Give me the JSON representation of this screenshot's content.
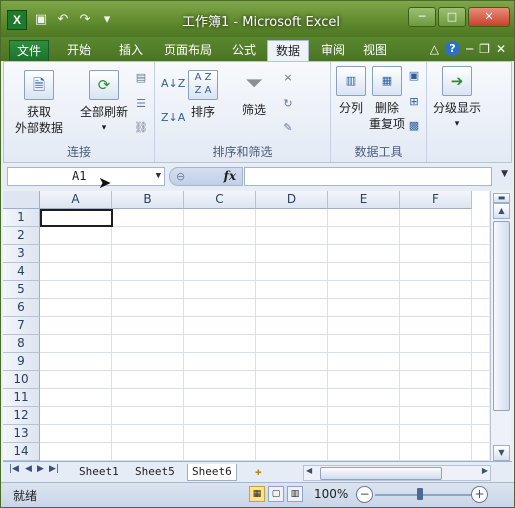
{
  "titlebar": {
    "title": "工作簿1 - Microsoft Excel",
    "app_logo": "X",
    "qat_icons": [
      "save-icon",
      "undo-icon",
      "redo-icon",
      "customize-icon"
    ]
  },
  "tabs": [
    {
      "label": "文件",
      "name": "tab-file"
    },
    {
      "label": "开始",
      "name": "tab-home"
    },
    {
      "label": "插入",
      "name": "tab-insert"
    },
    {
      "label": "页面布局",
      "name": "tab-page-layout"
    },
    {
      "label": "公式",
      "name": "tab-formulas"
    },
    {
      "label": "数据",
      "name": "tab-data"
    },
    {
      "label": "审阅",
      "name": "tab-review"
    },
    {
      "label": "视图",
      "name": "tab-view"
    }
  ],
  "ribbon": {
    "get_external_data": "获取\n外部数据",
    "refresh_all": "全部刷新",
    "group_connections": "连接",
    "sort": "排序",
    "filter": "筛选",
    "group_sort_filter": "排序和筛选",
    "text_to_columns": "分列",
    "remove_duplicates_1": "删除",
    "remove_duplicates_2": "重复项",
    "group_data_tools": "数据工具",
    "outline": "分级显示",
    "sort_az": "A↓Z",
    "sort_za": "Z↓A"
  },
  "formula_bar": {
    "name_box": "A1",
    "fx": "fx",
    "formula": ""
  },
  "grid": {
    "columns": [
      "A",
      "B",
      "C",
      "D",
      "E",
      "F"
    ],
    "rows": [
      "1",
      "2",
      "3",
      "4",
      "5",
      "6",
      "7",
      "8",
      "9",
      "10",
      "11",
      "12",
      "13",
      "14"
    ]
  },
  "sheets": {
    "tabs": [
      "Sheet1",
      "Sheet5",
      "Sheet6"
    ],
    "active": "Sheet6"
  },
  "status": {
    "ready": "就绪",
    "zoom": "100%"
  },
  "colors": {
    "titlebar": "#5f8a2d",
    "accent": "#1f7a2e"
  }
}
